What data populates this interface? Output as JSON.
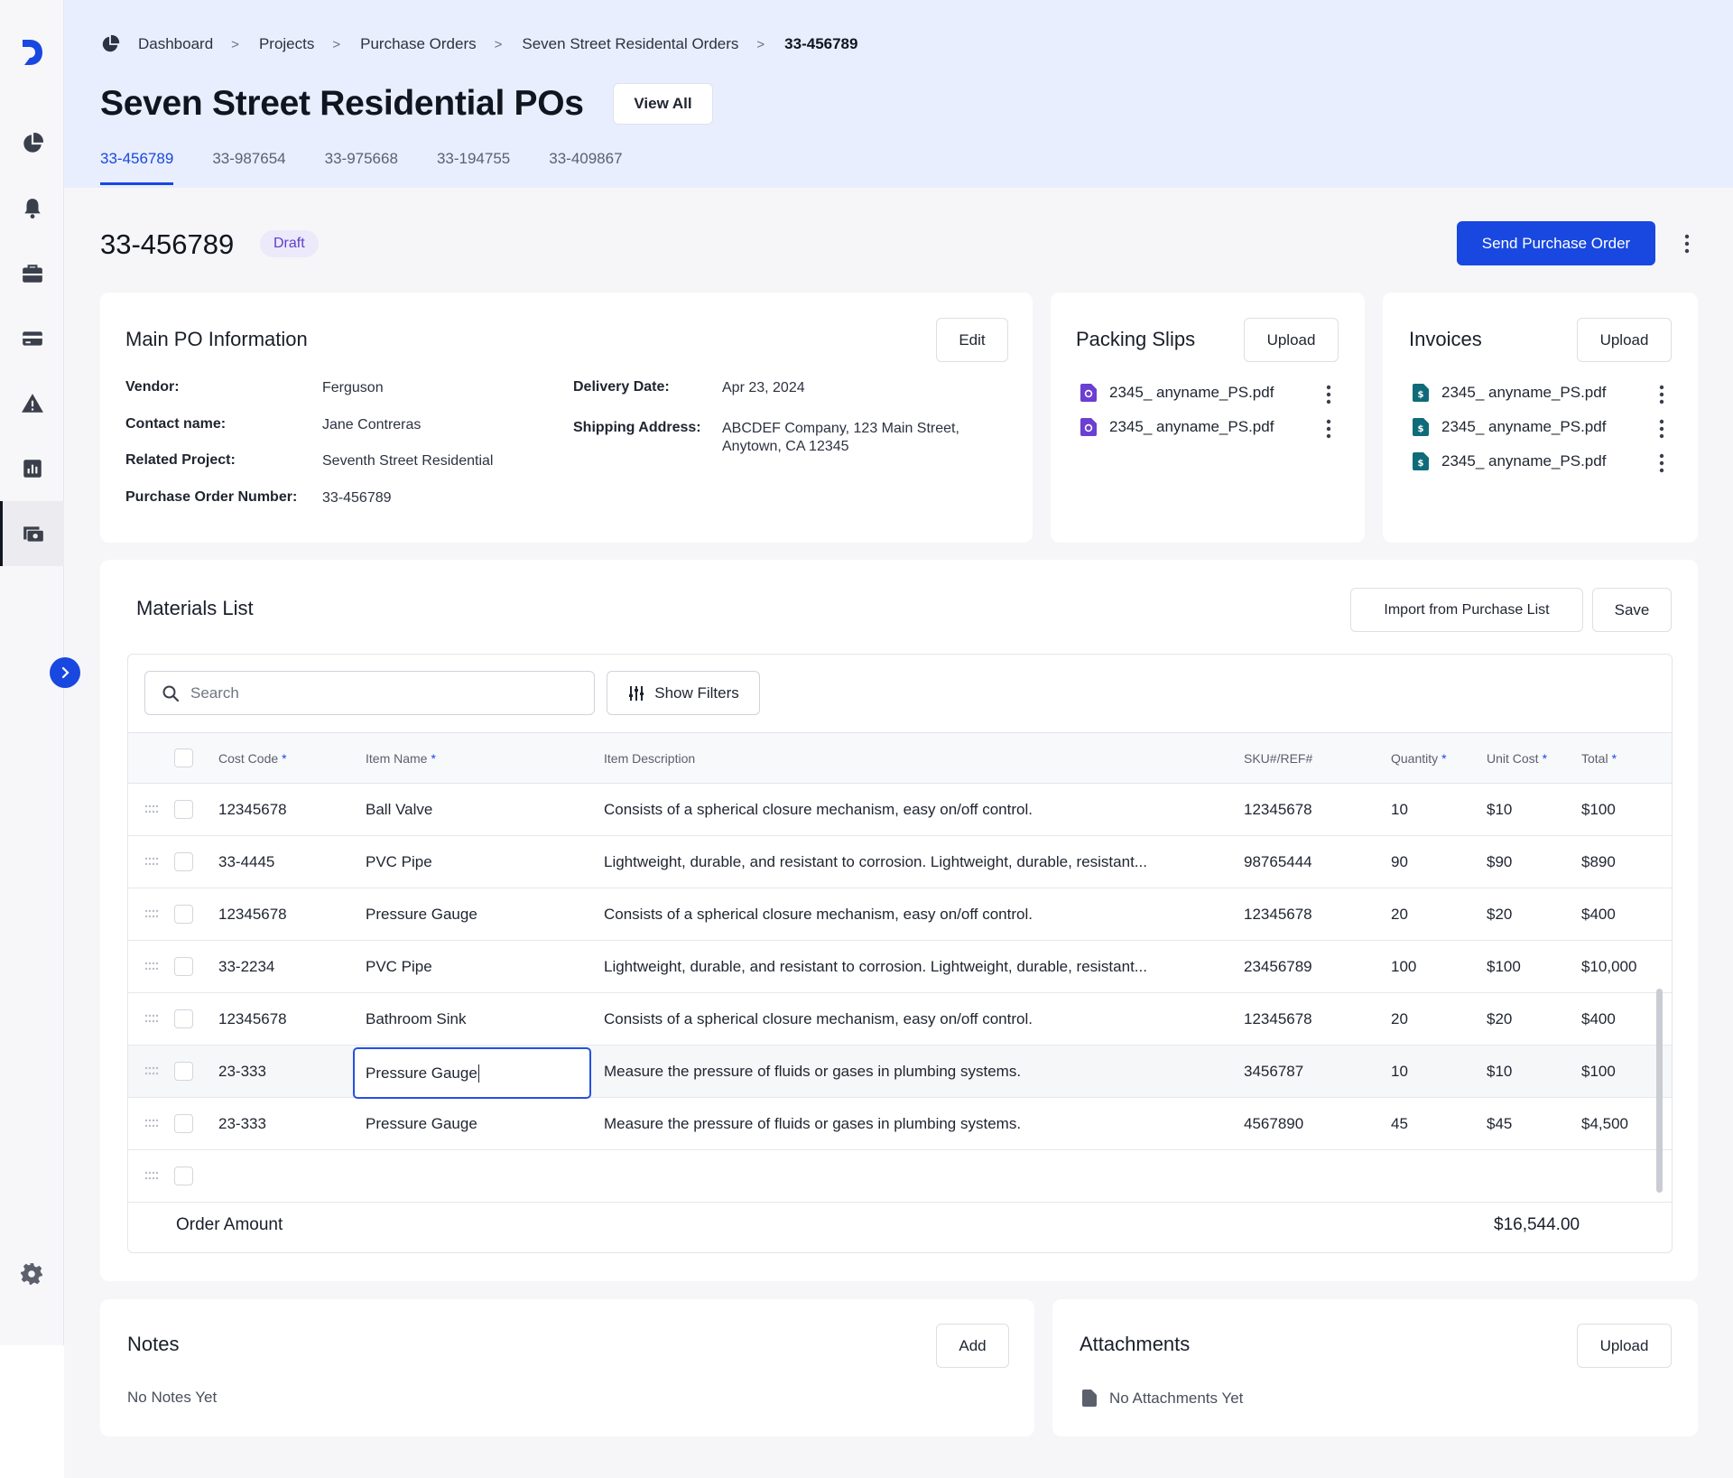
{
  "sidebar": {
    "icons": [
      "logo-icon",
      "dashboard-icon",
      "bell-icon",
      "briefcase-icon",
      "credit-card-icon",
      "warning-icon",
      "chart-icon",
      "purchase-orders-icon",
      "settings-icon"
    ]
  },
  "breadcrumbs": [
    "Dashboard",
    "Projects",
    "Purchase Orders",
    "Seven Street Residental Orders",
    "33-456789"
  ],
  "header": {
    "title": "Seven Street Residential POs",
    "view_all": "View All",
    "tabs": [
      "33-456789",
      "33-987654",
      "33-975668",
      "33-194755",
      "33-409867"
    ]
  },
  "po": {
    "number": "33-456789",
    "status": "Draft",
    "send_label": "Send Purchase Order"
  },
  "main_info": {
    "title": "Main PO Information",
    "edit_label": "Edit",
    "fields": {
      "vendor_label": "Vendor:",
      "vendor": "Ferguson",
      "contact_label": "Contact name:",
      "contact": "Jane Contreras",
      "project_label": "Related Project:",
      "project": "Seventh Street Residential",
      "po_number_label": "Purchase Order Number:",
      "po_number": "33-456789",
      "delivery_label": "Delivery Date:",
      "delivery": "Apr 23, 2024",
      "shipping_label": "Shipping Address:",
      "shipping_line1": "ABCDEF Company, 123 Main Street,",
      "shipping_line2": "Anytown, CA 12345"
    }
  },
  "packing_slips": {
    "title": "Packing Slips",
    "upload_label": "Upload",
    "files": [
      "2345_ anyname_PS.pdf",
      "2345_ anyname_PS.pdf"
    ]
  },
  "invoices": {
    "title": "Invoices",
    "upload_label": "Upload",
    "files": [
      "2345_ anyname_PS.pdf",
      "2345_ anyname_PS.pdf",
      "2345_ anyname_PS.pdf"
    ]
  },
  "materials": {
    "title": "Materials List",
    "import_label": "Import from Purchase  List",
    "save_label": "Save",
    "search_placeholder": "Search",
    "filters_label": "Show Filters",
    "columns": {
      "cost_code": "Cost Code",
      "item_name": "Item Name",
      "description": "Item Description",
      "sku": "SKU#/REF#",
      "quantity": "Quantity",
      "unit_cost": "Unit Cost",
      "total": "Total",
      "required_mark": "*"
    },
    "rows": [
      {
        "cost_code": "12345678",
        "item": "Ball Valve",
        "description": "Consists of a spherical closure mechanism, easy on/off control.",
        "sku": "12345678",
        "qty": "10",
        "unit": "$10",
        "total": "$100"
      },
      {
        "cost_code": "33-4445",
        "item": "PVC Pipe",
        "description": "Lightweight, durable, and resistant to corrosion. Lightweight, durable, resistant...",
        "sku": "98765444",
        "qty": "90",
        "unit": "$90",
        "total": "$890"
      },
      {
        "cost_code": "12345678",
        "item": "Pressure Gauge",
        "description": "Consists of a spherical closure mechanism, easy on/off control.",
        "sku": "12345678",
        "qty": "20",
        "unit": "$20",
        "total": "$400"
      },
      {
        "cost_code": "33-2234",
        "item": "PVC Pipe",
        "description": "Lightweight, durable, and resistant to corrosion. Lightweight, durable, resistant...",
        "sku": "23456789",
        "qty": "100",
        "unit": "$100",
        "total": "$10,000"
      },
      {
        "cost_code": "12345678",
        "item": "Bathroom Sink",
        "description": "Consists of a spherical closure mechanism, easy on/off control.",
        "sku": "12345678",
        "qty": "20",
        "unit": "$20",
        "total": "$400"
      },
      {
        "cost_code": "23-333",
        "item": "Pressure Gauge",
        "description": "Measure the pressure of fluids or gases in plumbing systems.",
        "sku": "3456787",
        "qty": "10",
        "unit": "$10",
        "total": "$100"
      },
      {
        "cost_code": "23-333",
        "item": "Pressure Gauge",
        "description": "Measure the pressure of fluids or gases in plumbing systems.",
        "sku": "4567890",
        "qty": "45",
        "unit": "$45",
        "total": "$4,500"
      }
    ],
    "order_amount_label": "Order Amount",
    "order_amount": "$16,544.00"
  },
  "notes": {
    "title": "Notes",
    "add_label": "Add",
    "empty": "No Notes Yet"
  },
  "attachments": {
    "title": "Attachments",
    "upload_label": "Upload",
    "empty": "No Attachments Yet"
  },
  "colors": {
    "accent": "#1848e0",
    "header_bg": "#e8eefd",
    "draft_badge_bg": "#ece9fb",
    "draft_badge_text": "#5b3fc9",
    "packing_slip_icon": "#6a3fd1",
    "invoice_icon": "#0f6b7a"
  }
}
